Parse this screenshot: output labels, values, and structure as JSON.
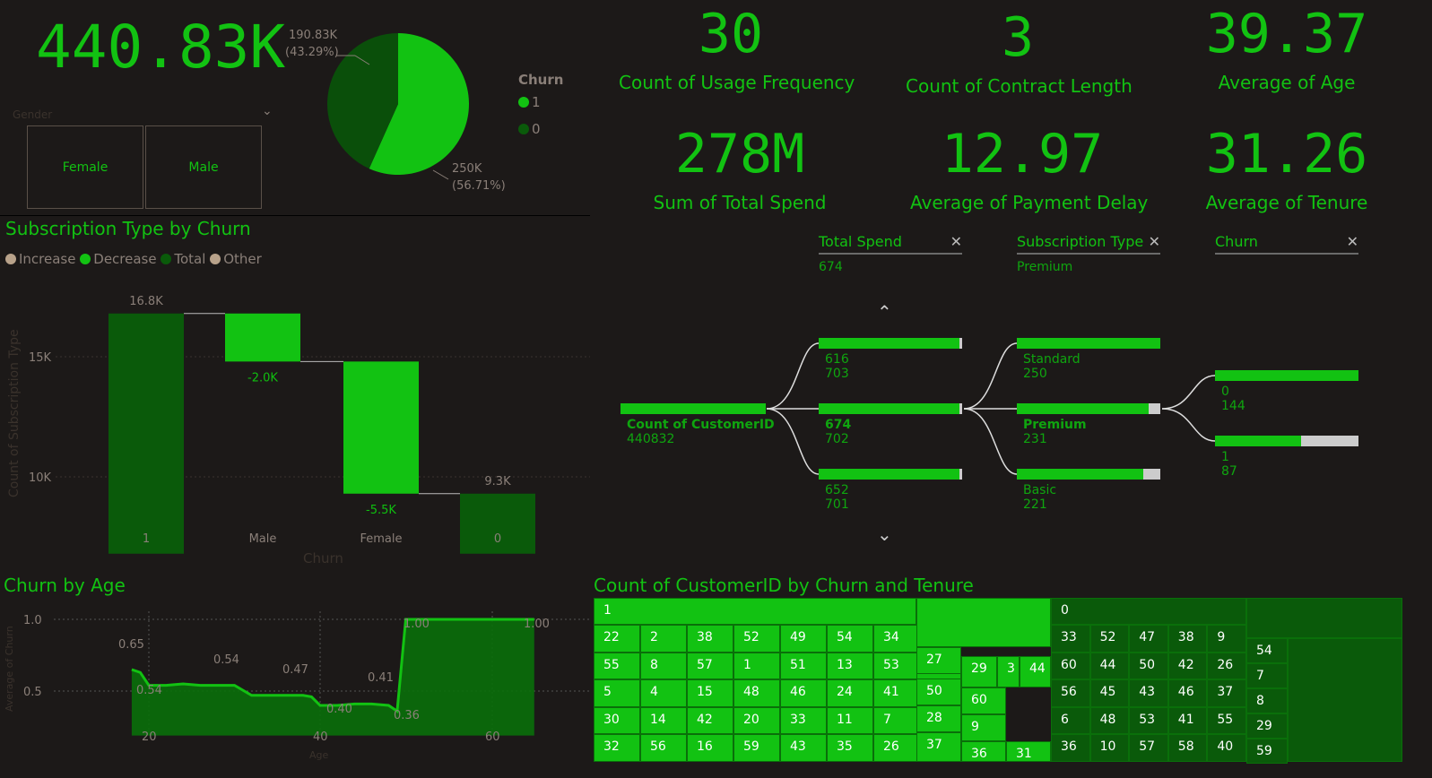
{
  "kpis": {
    "churn_total": "440.83K",
    "usage_freq": {
      "value": "30",
      "label": "Count of Usage Frequency"
    },
    "contract_len": {
      "value": "3",
      "label": "Count of Contract Length"
    },
    "avg_age": {
      "value": "39.37",
      "label": "Average of Age"
    },
    "total_spend": {
      "value": "278M",
      "label": "Sum of Total Spend"
    },
    "payment_delay": {
      "value": "12.97",
      "label": "Average of Payment Delay"
    },
    "tenure": {
      "value": "31.26",
      "label": "Average of Tenure"
    }
  },
  "slicer": {
    "title": "Gender",
    "options": [
      "Female",
      "Male"
    ]
  },
  "pie": {
    "legend_title": "Churn",
    "legend": [
      {
        "label": "1",
        "color": "#12c212"
      },
      {
        "label": "0",
        "color": "#0a5a0a"
      }
    ],
    "label_top": [
      "190.83K",
      "(43.29%)"
    ],
    "label_bottom": [
      "250K",
      "(56.71%)"
    ],
    "slices": [
      {
        "label": "1",
        "value": 250000,
        "pct": 56.71,
        "color": "#12c212"
      },
      {
        "label": "0",
        "value": 190830,
        "pct": 43.29,
        "color": "#0a4f0a"
      }
    ]
  },
  "waterfall": {
    "title": "Subscription Type by Churn",
    "legend": [
      {
        "label": "Increase",
        "color": "#b8a28a"
      },
      {
        "label": "Decrease",
        "color": "#12c212"
      },
      {
        "label": "Total",
        "color": "#0a5a0a"
      },
      {
        "label": "Other",
        "color": "#b8a28a"
      }
    ],
    "ylabel": "Count of Subscription Type",
    "xlabel": "Churn",
    "yticks": [
      "15K",
      "10K"
    ],
    "bar_labels": [
      "16.8K",
      "-2.0K",
      "-5.5K",
      "9.3K"
    ]
  },
  "decomp": {
    "headers": [
      {
        "title": "Total Spend",
        "sub": "674"
      },
      {
        "title": "Subscription Type",
        "sub": "Premium"
      },
      {
        "title": "Churn",
        "sub": ""
      }
    ],
    "root": {
      "label": "Count of CustomerID",
      "value": "440832"
    },
    "level1": [
      {
        "label": "616",
        "value": "703",
        "fill": 0.98
      },
      {
        "label": "674",
        "value": "702",
        "fill": 0.98
      },
      {
        "label": "652",
        "value": "701",
        "fill": 0.98
      }
    ],
    "level2": [
      {
        "label": "Standard",
        "value": "250",
        "fill": 1.0
      },
      {
        "label": "Premium",
        "value": "231",
        "fill": 0.92
      },
      {
        "label": "Basic",
        "value": "221",
        "fill": 0.88
      }
    ],
    "level3": [
      {
        "label": "0",
        "value": "144",
        "fill": 1.0
      },
      {
        "label": "1",
        "value": "87",
        "fill": 0.6
      }
    ],
    "up_icon": "chevron-up-icon",
    "down_icon": "chevron-down-icon"
  },
  "age_chart": {
    "title": "Churn by Age",
    "ylabel": "Average of Churn",
    "xlabel": "Age",
    "yticks": [
      "1.0",
      "0.5"
    ],
    "xticks": [
      "20",
      "40",
      "60"
    ],
    "annotations": [
      "0.65",
      "0.54",
      "0.54",
      "0.47",
      "0.40",
      "0.41",
      "0.36",
      "1.00",
      "1.00"
    ]
  },
  "treemap": {
    "title": "Count of CustomerID by Churn and Tenure",
    "group1_labels": [
      "1",
      "22",
      "2",
      "38",
      "52",
      "49",
      "54",
      "34",
      "55",
      "8",
      "57",
      "1",
      "51",
      "13",
      "53",
      "5",
      "4",
      "15",
      "48",
      "46",
      "24",
      "41",
      "30",
      "14",
      "42",
      "20",
      "33",
      "11",
      "7",
      "32",
      "56",
      "16",
      "59",
      "43",
      "35",
      "26",
      "27",
      "29",
      "3",
      "44",
      "50",
      "60",
      "28",
      "9",
      "37",
      "36",
      "31"
    ],
    "group0_labels": [
      "0",
      "33",
      "52",
      "47",
      "38",
      "9",
      "60",
      "44",
      "50",
      "42",
      "26",
      "56",
      "45",
      "43",
      "46",
      "37",
      "6",
      "48",
      "53",
      "41",
      "55",
      "36",
      "10",
      "57",
      "58",
      "40",
      "54",
      "7",
      "8",
      "29",
      "59"
    ]
  },
  "chart_data": [
    {
      "type": "pie",
      "title": "",
      "categories": [
        "1",
        "0"
      ],
      "values": [
        250000,
        190830
      ]
    },
    {
      "type": "bar",
      "title": "Subscription Type by Churn",
      "categories": [
        "1",
        "Male",
        "Female",
        "0"
      ],
      "values": [
        16.8,
        -2.0,
        -5.5,
        9.3
      ],
      "xlabel": "Churn",
      "ylabel": "Count of Subscription Type",
      "ylim": [
        6.5,
        19
      ]
    },
    {
      "type": "area",
      "title": "Churn by Age",
      "x": [
        18,
        19,
        20,
        22,
        24,
        26,
        28,
        30,
        32,
        34,
        36,
        38,
        39,
        40,
        42,
        44,
        46,
        48,
        49,
        50,
        52,
        54,
        56,
        58,
        60,
        62,
        64,
        65
      ],
      "values": [
        0.65,
        0.63,
        0.54,
        0.54,
        0.55,
        0.54,
        0.54,
        0.54,
        0.47,
        0.47,
        0.47,
        0.47,
        0.46,
        0.4,
        0.4,
        0.41,
        0.41,
        0.4,
        0.36,
        1.0,
        1.0,
        1.0,
        1.0,
        1.0,
        1.0,
        1.0,
        1.0,
        1.0
      ],
      "xlabel": "Age",
      "ylabel": "Average of Churn",
      "ylim": [
        0.1,
        1.05
      ]
    }
  ]
}
